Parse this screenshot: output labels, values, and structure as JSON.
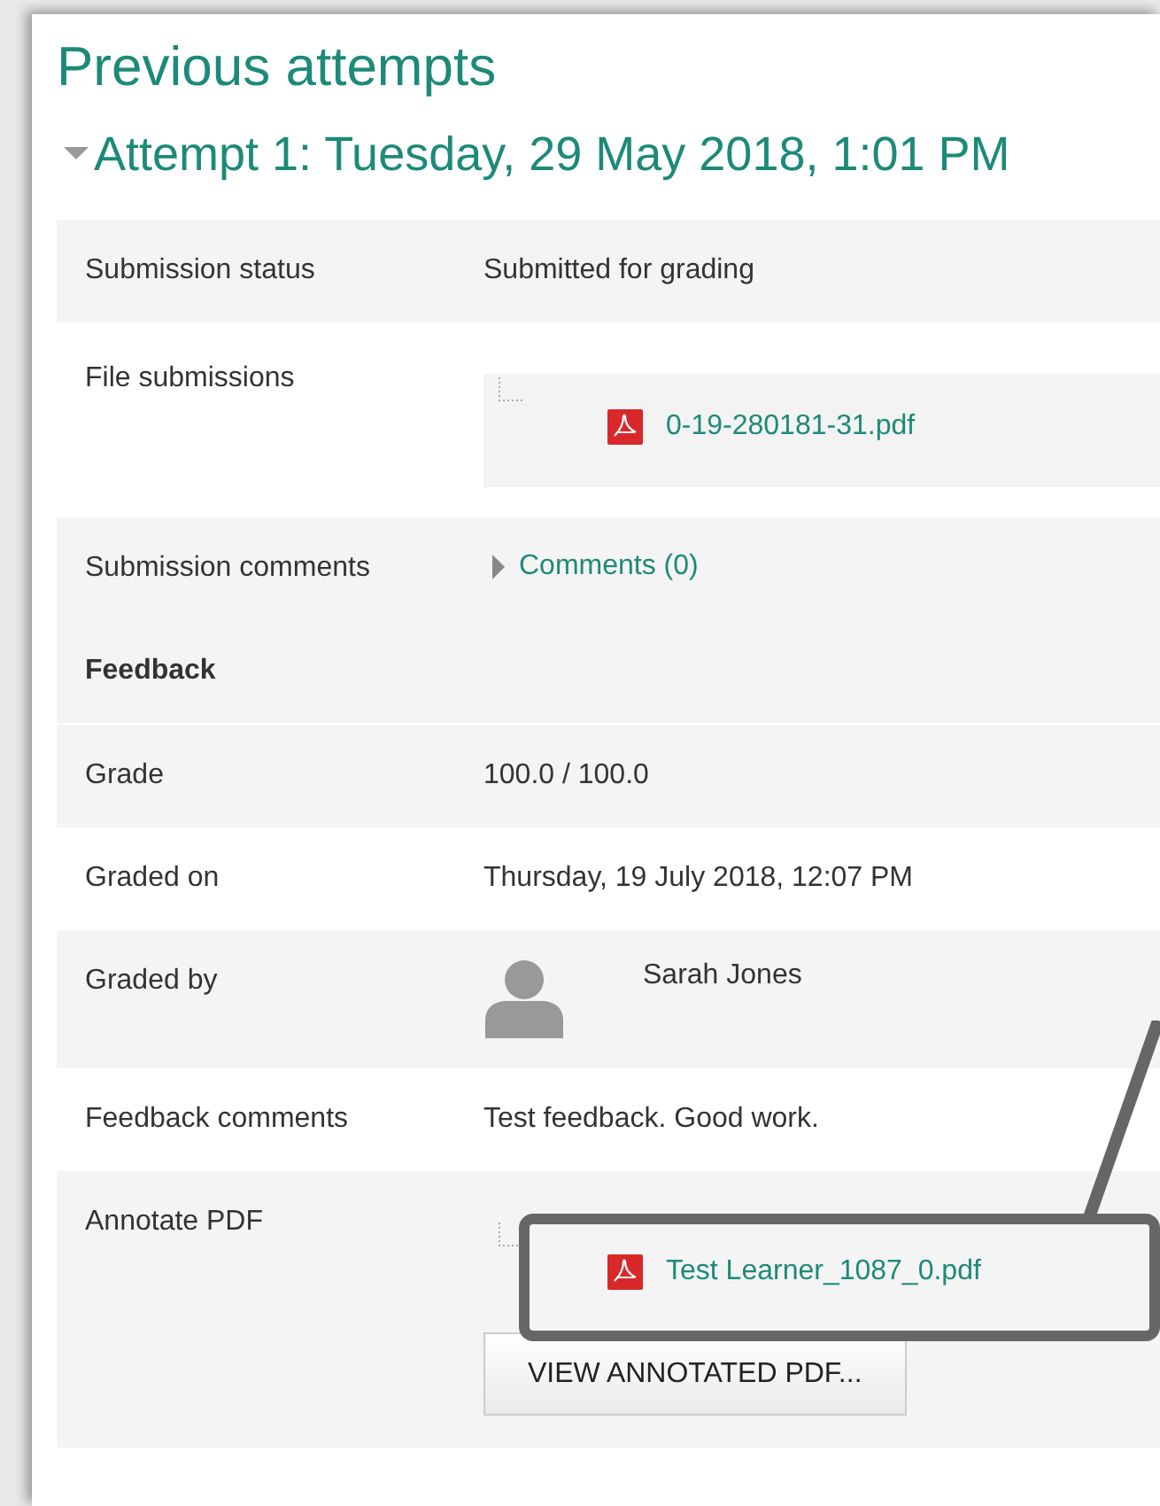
{
  "title": "Previous attempts",
  "attempt": {
    "title": "Attempt 1: Tuesday, 29 May 2018, 1:01 PM",
    "expanded": true
  },
  "submission": [
    {
      "kind": "text",
      "label": "Submission status",
      "value": "Submitted for grading"
    },
    {
      "kind": "file",
      "label": "File submissions",
      "file": "0-19-280181-31.pdf"
    },
    {
      "kind": "comments",
      "label": "Submission comments",
      "link": "Comments (0)",
      "expanded": false
    }
  ],
  "feedback": {
    "heading": "Feedback",
    "rows": [
      {
        "kind": "text",
        "label": "Grade",
        "value": "100.0 / 100.0"
      },
      {
        "kind": "text",
        "label": "Graded on",
        "value": "Thursday, 19 July 2018, 12:07 PM"
      },
      {
        "kind": "user",
        "label": "Graded by",
        "value": "Sarah Jones"
      },
      {
        "kind": "text",
        "label": "Feedback comments",
        "value": "Test feedback. Good work."
      },
      {
        "kind": "annotate",
        "label": "Annotate PDF",
        "file": "Test Learner_1087_0.pdf",
        "button": "VIEW ANNOTATED PDF..."
      }
    ]
  }
}
